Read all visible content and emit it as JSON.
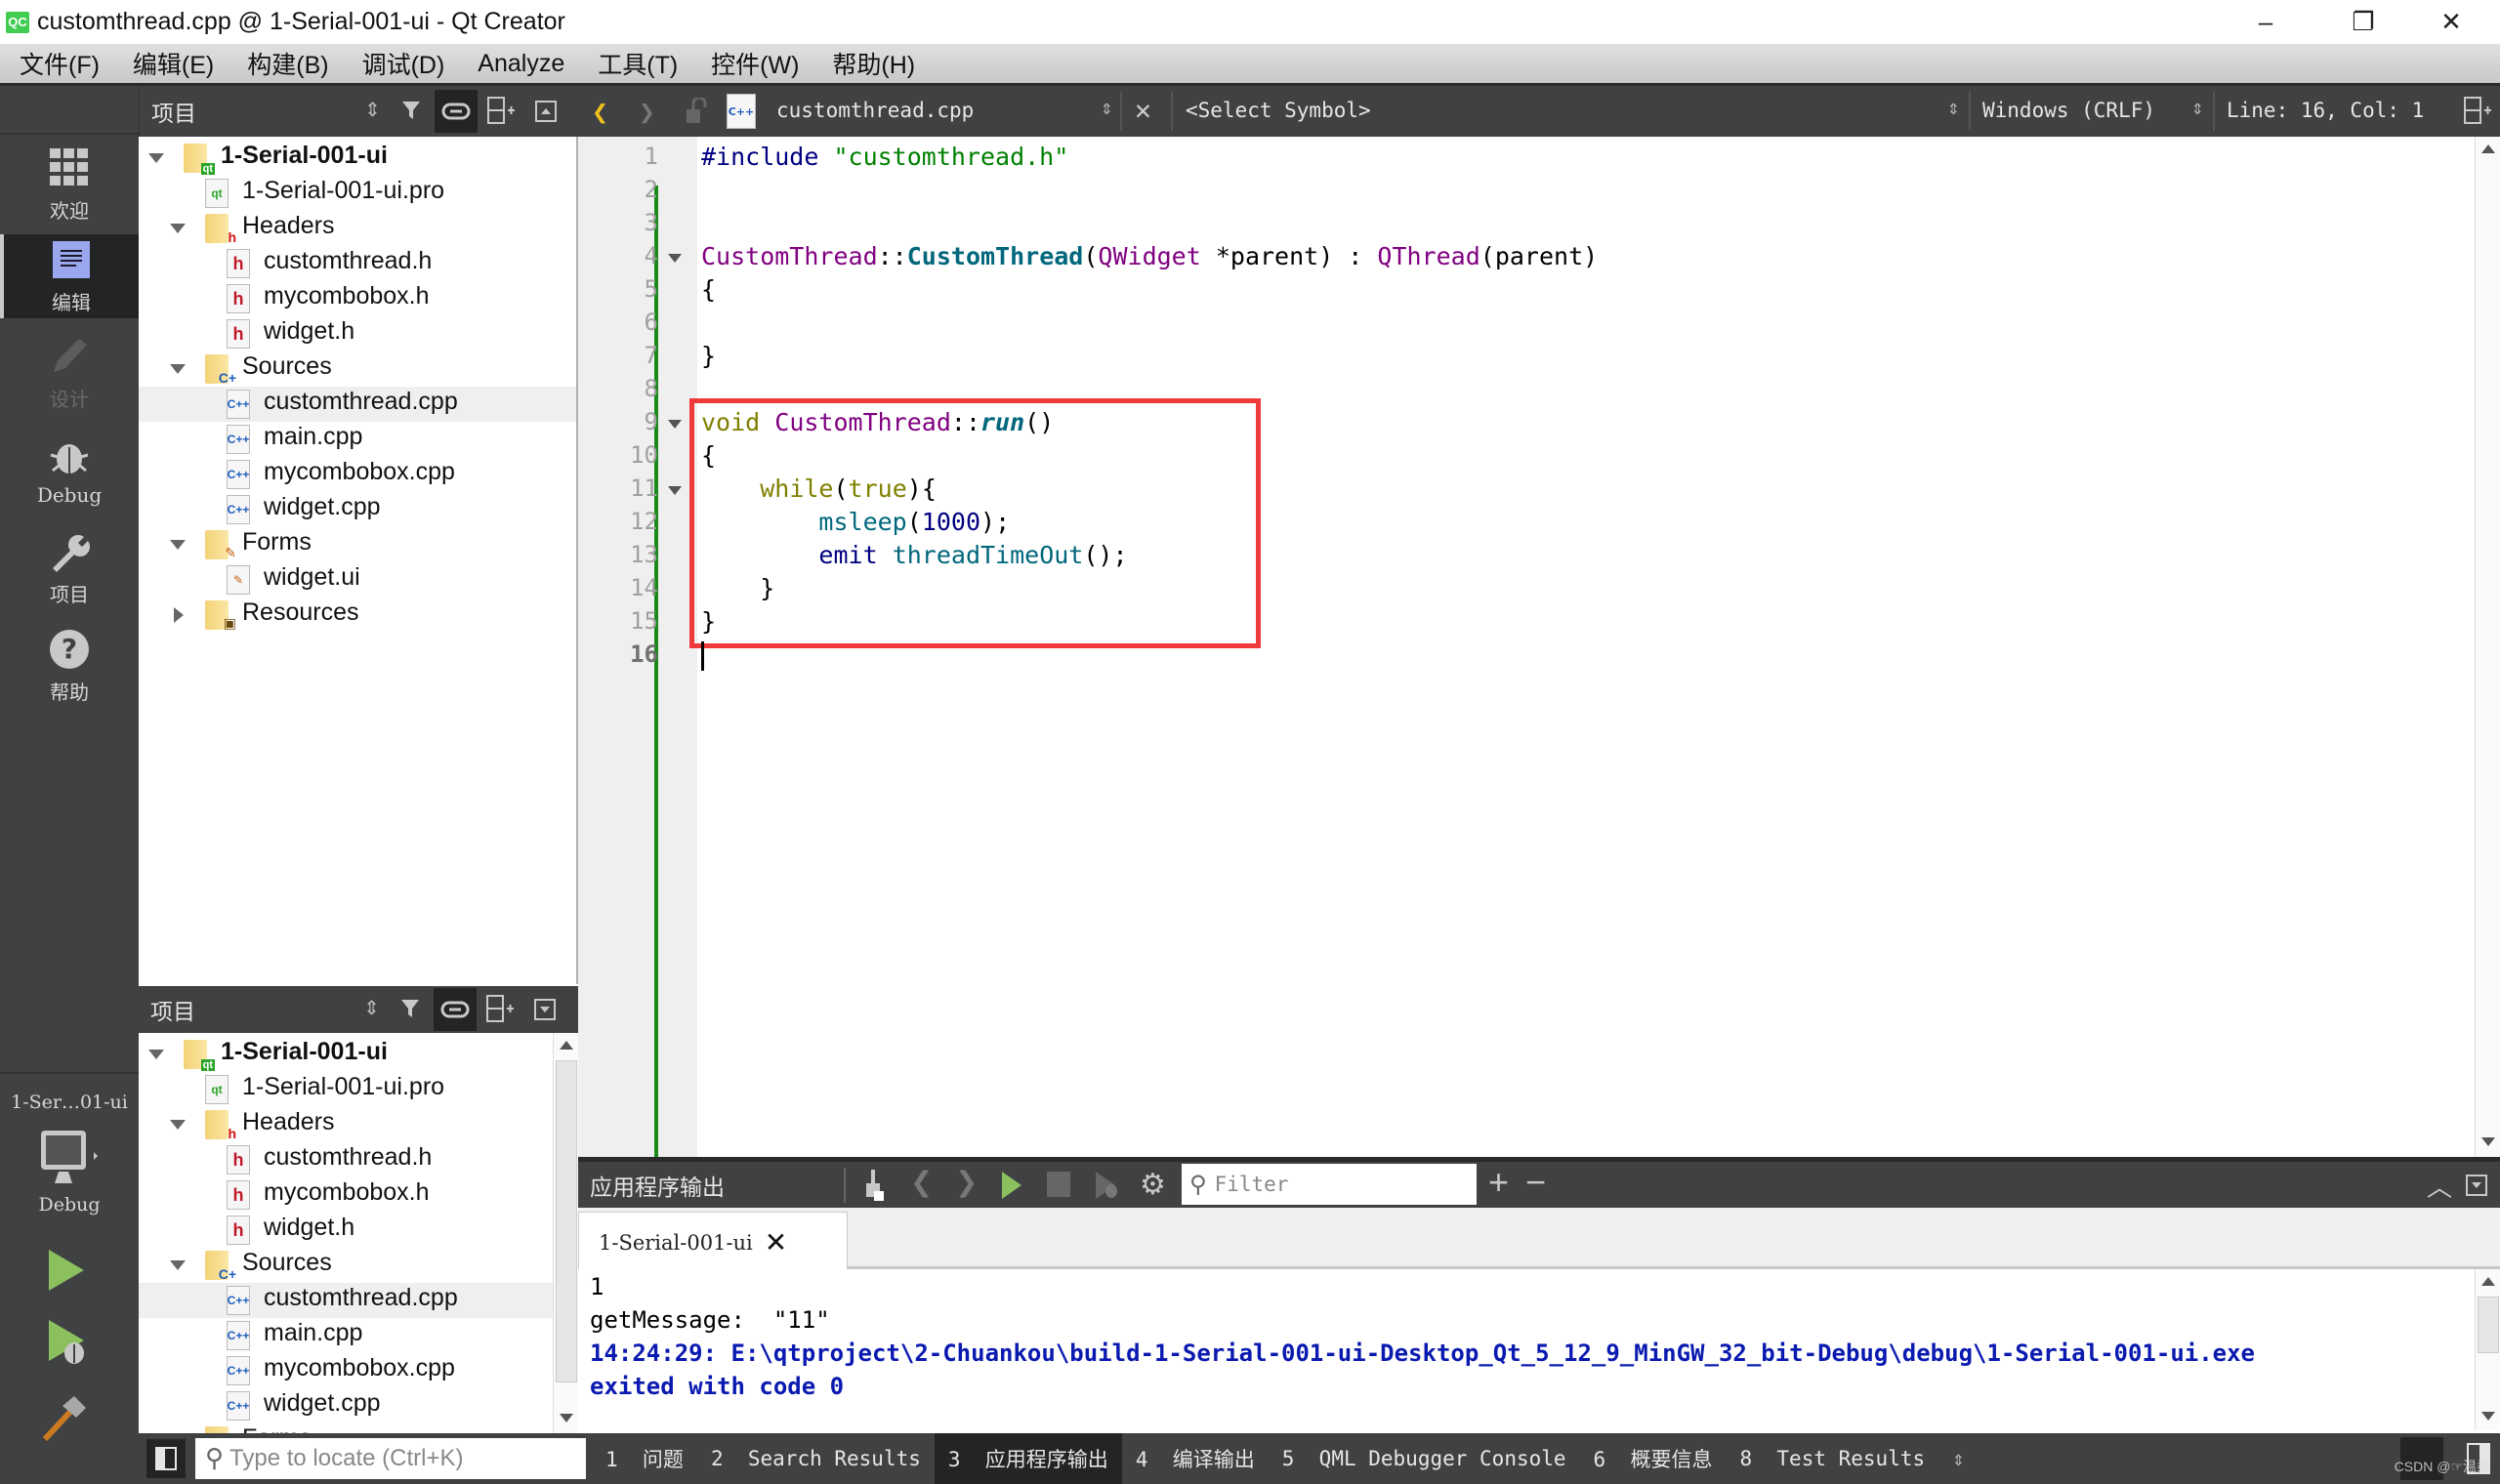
{
  "window": {
    "app_icon": "QC",
    "title": "customthread.cpp @ 1-Serial-001-ui - Qt Creator",
    "minimize": "–",
    "restore": "❐",
    "close": "✕"
  },
  "menu": [
    "文件(F)",
    "编辑(E)",
    "构建(B)",
    "调试(D)",
    "Analyze",
    "工具(T)",
    "控件(W)",
    "帮助(H)"
  ],
  "modes": [
    {
      "label": "欢迎",
      "icon": "welcome-grid-icon",
      "state": "normal"
    },
    {
      "label": "编辑",
      "icon": "edit-document-icon",
      "state": "active"
    },
    {
      "label": "设计",
      "icon": "design-pencil-icon",
      "state": "disabled"
    },
    {
      "label": "Debug",
      "icon": "debug-bug-icon",
      "state": "normal"
    },
    {
      "label": "项目",
      "icon": "projects-wrench-icon",
      "state": "normal"
    },
    {
      "label": "帮助",
      "icon": "help-question-icon",
      "state": "normal"
    }
  ],
  "kit_selector": {
    "project": "1-Ser…01-ui",
    "build": "Debug"
  },
  "project_panel_top": {
    "title": "项目",
    "tree": [
      {
        "label": "1-Serial-001-ui",
        "level": 0,
        "kind": "project",
        "expanded": true,
        "bold": true
      },
      {
        "label": "1-Serial-001-ui.pro",
        "level": 1,
        "kind": "pro"
      },
      {
        "label": "Headers",
        "level": 1,
        "kind": "folder-h",
        "expanded": true
      },
      {
        "label": "customthread.h",
        "level": 2,
        "kind": "h"
      },
      {
        "label": "mycombobox.h",
        "level": 2,
        "kind": "h"
      },
      {
        "label": "widget.h",
        "level": 2,
        "kind": "h"
      },
      {
        "label": "Sources",
        "level": 1,
        "kind": "folder-cpp",
        "expanded": true
      },
      {
        "label": "customthread.cpp",
        "level": 2,
        "kind": "cpp",
        "selected": true
      },
      {
        "label": "main.cpp",
        "level": 2,
        "kind": "cpp"
      },
      {
        "label": "mycombobox.cpp",
        "level": 2,
        "kind": "cpp"
      },
      {
        "label": "widget.cpp",
        "level": 2,
        "kind": "cpp"
      },
      {
        "label": "Forms",
        "level": 1,
        "kind": "folder-ui",
        "expanded": true
      },
      {
        "label": "widget.ui",
        "level": 2,
        "kind": "ui"
      },
      {
        "label": "Resources",
        "level": 1,
        "kind": "folder-res",
        "expanded": false
      }
    ]
  },
  "project_panel_bottom": {
    "title": "项目",
    "tree": [
      {
        "label": "1-Serial-001-ui",
        "level": 0,
        "kind": "project",
        "expanded": true,
        "bold": true
      },
      {
        "label": "1-Serial-001-ui.pro",
        "level": 1,
        "kind": "pro"
      },
      {
        "label": "Headers",
        "level": 1,
        "kind": "folder-h",
        "expanded": true
      },
      {
        "label": "customthread.h",
        "level": 2,
        "kind": "h"
      },
      {
        "label": "mycombobox.h",
        "level": 2,
        "kind": "h"
      },
      {
        "label": "widget.h",
        "level": 2,
        "kind": "h"
      },
      {
        "label": "Sources",
        "level": 1,
        "kind": "folder-cpp",
        "expanded": true
      },
      {
        "label": "customthread.cpp",
        "level": 2,
        "kind": "cpp",
        "selected": true
      },
      {
        "label": "main.cpp",
        "level": 2,
        "kind": "cpp"
      },
      {
        "label": "mycombobox.cpp",
        "level": 2,
        "kind": "cpp"
      },
      {
        "label": "widget.cpp",
        "level": 2,
        "kind": "cpp"
      },
      {
        "label": "Forms",
        "level": 1,
        "kind": "folder-ui",
        "expanded": true
      }
    ]
  },
  "editor": {
    "file_name": "customthread.cpp",
    "symbol": "<Select Symbol>",
    "line_ending": "Windows (CRLF)",
    "cursor": "Line: 16, Col: 1",
    "current_line": 16,
    "highlight_box_color": "#f0393a",
    "lines": [
      {
        "n": 1,
        "tokens": [
          [
            "pp",
            "#include "
          ],
          [
            "str",
            "\"customthread.h\""
          ]
        ]
      },
      {
        "n": 2,
        "tokens": []
      },
      {
        "n": 3,
        "tokens": []
      },
      {
        "n": 4,
        "fold": true,
        "tokens": [
          [
            "ty",
            "CustomThread"
          ],
          [
            "",
            "::"
          ],
          [
            "fn bold",
            "CustomThread"
          ],
          [
            "",
            "("
          ],
          [
            "ty",
            "QWidget"
          ],
          [
            "",
            " *"
          ],
          [
            "",
            "parent"
          ],
          [
            "",
            ") : "
          ],
          [
            "ty",
            "QThread"
          ],
          [
            "",
            "(parent)"
          ]
        ]
      },
      {
        "n": 5,
        "tokens": [
          [
            "",
            "{"
          ]
        ]
      },
      {
        "n": 6,
        "tokens": []
      },
      {
        "n": 7,
        "tokens": [
          [
            "",
            "}"
          ]
        ]
      },
      {
        "n": 8,
        "tokens": []
      },
      {
        "n": 9,
        "fold": true,
        "tokens": [
          [
            "kw",
            "void "
          ],
          [
            "ty",
            "CustomThread"
          ],
          [
            "",
            "::"
          ],
          [
            "fn ital",
            "run"
          ],
          [
            "",
            "()"
          ]
        ]
      },
      {
        "n": 10,
        "tokens": [
          [
            "",
            "{"
          ]
        ]
      },
      {
        "n": 11,
        "fold": true,
        "tokens": [
          [
            "",
            "    "
          ],
          [
            "kw",
            "while"
          ],
          [
            "",
            "("
          ],
          [
            "kw",
            "true"
          ],
          [
            "",
            "){"
          ]
        ]
      },
      {
        "n": 12,
        "tokens": [
          [
            "",
            "        "
          ],
          [
            "fn",
            "msleep"
          ],
          [
            "",
            "("
          ],
          [
            "num",
            "1000"
          ],
          [
            "",
            ");"
          ]
        ]
      },
      {
        "n": 13,
        "tokens": [
          [
            "",
            "        "
          ],
          [
            "num",
            "emit "
          ],
          [
            "fn",
            "threadTimeOut"
          ],
          [
            "",
            "();"
          ]
        ]
      },
      {
        "n": 14,
        "tokens": [
          [
            "",
            "    }"
          ]
        ]
      },
      {
        "n": 15,
        "tokens": [
          [
            "",
            "}"
          ]
        ]
      },
      {
        "n": 16,
        "tokens": []
      }
    ]
  },
  "output_pane": {
    "title": "应用程序输出",
    "filter_placeholder": "Filter",
    "tab_label": "1-Serial-001-ui",
    "lines": [
      {
        "text": "1",
        "style": "normal"
      },
      {
        "text": "getMessage:  \"11\"",
        "style": "normal"
      },
      {
        "text": "14:24:29: E:\\qtproject\\2-Chuankou\\build-1-Serial-001-ui-Desktop_Qt_5_12_9_MinGW_32_bit-Debug\\debug\\1-Serial-001-ui.exe",
        "style": "system"
      },
      {
        "text": "exited with code 0",
        "style": "system"
      }
    ]
  },
  "status_bar": {
    "locator_placeholder": "Type to locate (Ctrl+K)",
    "tabs": [
      {
        "label": "1  问题",
        "active": false
      },
      {
        "label": "2  Search Results",
        "active": false
      },
      {
        "label": "3  应用程序输出",
        "active": true
      },
      {
        "label": "4  编译输出",
        "active": false
      },
      {
        "label": "5  QML Debugger Console",
        "active": false
      },
      {
        "label": "6  概要信息",
        "active": false
      },
      {
        "label": "8  Test Results",
        "active": false
      }
    ],
    "watermark": "CSDN @☞温柔"
  },
  "colors": {
    "chrome_dark": "#404142",
    "selected_mode": "#232425",
    "edit_icon_bg": "#9aa6ee",
    "run_green": "#8cbf5e",
    "gutter_change": "#1a8a1a"
  }
}
